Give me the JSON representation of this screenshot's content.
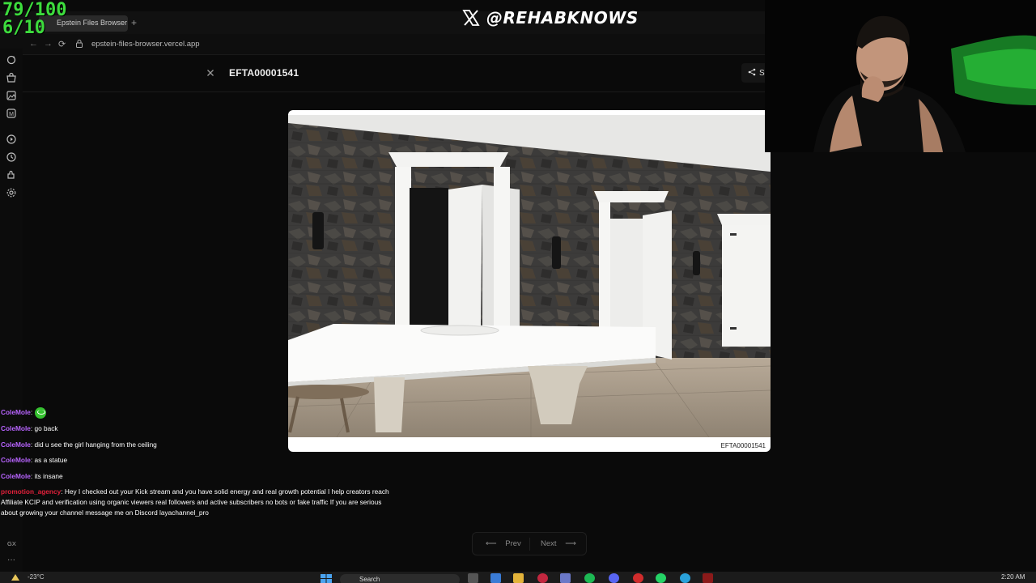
{
  "overlay": {
    "score_line1": "79/100",
    "score_line2": "6/10",
    "social_handle": "@REHABKNOWS",
    "social_icon": "x-logo-icon"
  },
  "browser": {
    "tab_title": "Epstein Files Browser",
    "new_tab": "+",
    "url": "epstein-files-browser.vercel.app",
    "back": "←",
    "forward": "→",
    "reload": "⟳"
  },
  "page": {
    "document_title": "EFTA00001541",
    "share_label": "Share",
    "image_caption": "EFTA00001541",
    "prev_label": "Prev",
    "next_label": "Next",
    "prev_arrow": "⟵",
    "next_arrow": "⟶"
  },
  "chat": {
    "messages": [
      {
        "user": "ColeMole",
        "text": "",
        "emote": "green-smile-emote"
      },
      {
        "user": "ColeMole",
        "text": "go back"
      },
      {
        "user": "ColeMole",
        "text": "did u see the girl hanging from the ceiling"
      },
      {
        "user": "ColeMole",
        "text": "as a statue"
      },
      {
        "user": "ColeMole",
        "text": "its insane"
      },
      {
        "user": "promotion_agency",
        "text": "Hey I checked out your Kick stream and you have solid energy and real growth potential I help creators reach Affiliate KCIP and verification using organic viewers real followers and active subscribers no bots or fake traffic If you are serious about growing your channel message me on Discord layachannel_pro"
      }
    ]
  },
  "sidebar": {
    "gx_label": "GX",
    "more": "···"
  },
  "taskbar": {
    "weather": "-23°C",
    "search_placeholder": "Search",
    "time": "2:20 AM"
  },
  "colors": {
    "score_green": "#3ddc3d",
    "chat_user": "#b864ff",
    "promo_user": "#e0203a",
    "background": "#0a0a0a"
  }
}
